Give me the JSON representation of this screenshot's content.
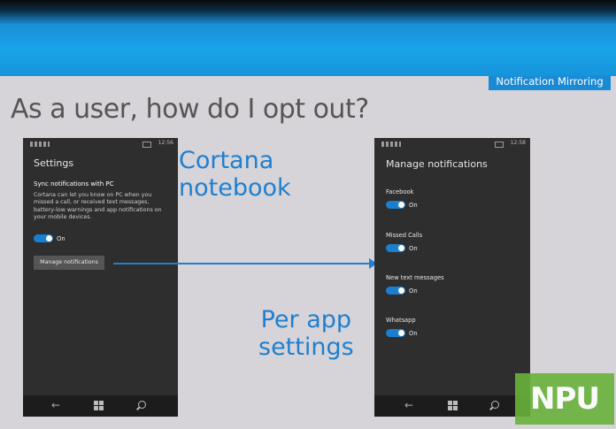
{
  "slide": {
    "tag": "Notification Mirroring",
    "title": "As a user, how do I opt out?",
    "caption_cortana": "Cortana notebook",
    "caption_cortana_line1": "Cortana",
    "caption_cortana_line2": "notebook",
    "caption_perapp_line1": "Per app",
    "caption_perapp_line2": "settings",
    "watermark": "NPU"
  },
  "phone_left": {
    "time": "12:56",
    "title": "Settings",
    "section": "Sync notifications with PC",
    "description": "Cortana can let you know on PC when you missed a call, or received text messages, battery-low warnings and app notifications on your mobile devices.",
    "toggle_label": "On",
    "toggle_on": true,
    "button_label": "Manage notifications"
  },
  "phone_right": {
    "time": "12:58",
    "title": "Manage notifications",
    "items": [
      {
        "label": "Facebook",
        "toggle_label": "On",
        "on": true
      },
      {
        "label": "Missed Calls",
        "toggle_label": "On",
        "on": true
      },
      {
        "label": "New text messages",
        "toggle_label": "On",
        "on": true
      },
      {
        "label": "Whatsapp",
        "toggle_label": "On",
        "on": true
      }
    ]
  },
  "colors": {
    "accent": "#1a8ad4",
    "phone_bg": "#2e2e2e",
    "slide_bg": "#d6d4d8",
    "watermark_bg": "#6ab23c"
  },
  "icons": {
    "nav": [
      "back-arrow-icon",
      "windows-start-icon",
      "search-icon"
    ]
  }
}
